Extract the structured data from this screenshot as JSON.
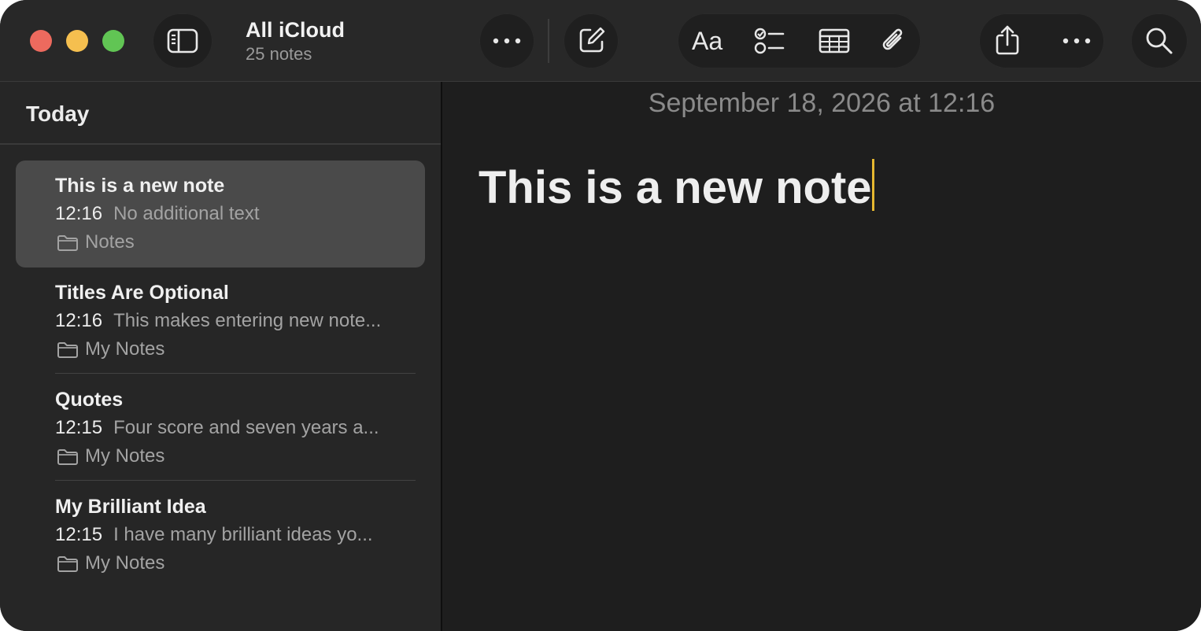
{
  "window": {
    "title": "All iCloud",
    "subtitle": "25 notes"
  },
  "toolbar": {
    "format_label": "Aa",
    "icons": [
      "sidebar-toggle-icon",
      "more-icon",
      "compose-icon",
      "checklist-icon",
      "table-icon",
      "attachment-icon",
      "share-icon",
      "more-icon",
      "search-icon"
    ]
  },
  "sidebar": {
    "section_title": "Today",
    "notes": [
      {
        "title": "This is a new note",
        "time": "12:16",
        "preview": "No additional text",
        "folder": "Notes",
        "selected": true
      },
      {
        "title": "Titles Are Optional",
        "time": "12:16",
        "preview": "This makes entering new note...",
        "folder": "My Notes",
        "selected": false
      },
      {
        "title": "Quotes",
        "time": "12:15",
        "preview": "Four score and seven years a...",
        "folder": "My Notes",
        "selected": false
      },
      {
        "title": "My Brilliant Idea",
        "time": "12:15",
        "preview": "I have many brilliant ideas yo...",
        "folder": "My Notes",
        "selected": false
      }
    ]
  },
  "editor": {
    "date": "September 18, 2026 at 12:16",
    "heading": "This is a new note"
  },
  "colors": {
    "close": "#ed6a5e",
    "minimize": "#f5bf4f",
    "zoom": "#61c554",
    "caret": "#e6b830",
    "selection": "#4a4a4a"
  }
}
